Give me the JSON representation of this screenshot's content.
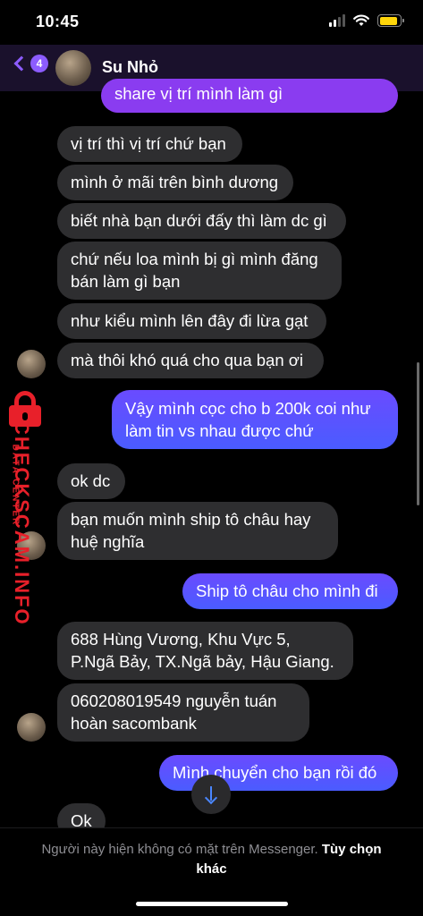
{
  "status": {
    "time": "10:45",
    "battery_level": 0.9
  },
  "header": {
    "back_badge": "4",
    "contact_name": "Su Nhỏ"
  },
  "messages": {
    "m0": "share vị trí mình làm gì",
    "m1": "vị trí thì vị trí chứ bạn",
    "m2": "mình ở mãi trên bình dương",
    "m3": "biết nhà bạn dưới đấy thì làm dc gì",
    "m4": "chứ nếu loa mình bị gì mình đăng\nbán làm gì bạn",
    "m5": "như kiểu mình lên đây đi lừa gạt",
    "m6": "mà thôi khó quá cho qua bạn ơi",
    "m7": "Vậy mình cọc cho b 200k coi như\nlàm tin vs nhau được chứ",
    "m8": "ok dc",
    "m9": "bạn muốn mình ship tô châu hay\nhuệ nghĩa",
    "m10": "Ship tô châu cho mình đi",
    "m11": "688 Hùng Vương, Khu Vực 5,\nP.Ngã Bảy, TX.Ngã bảy, Hậu Giang.",
    "m12": "060208019549 nguyễn tuán\nhoàn sacombank",
    "m13": "Mình chuyển cho bạn rồi đó",
    "m14": "Ok"
  },
  "watermark": {
    "brand": "CHECKSCAM.INFO",
    "sub": "DATA CENTER"
  },
  "footer": {
    "notice": "Người này hiện không có mặt trên Messenger.",
    "link": "Tùy chọn khác"
  },
  "colors": {
    "accent": "#8c5cff",
    "incoming": "#2e2e30",
    "outgoing": "#5a55ff",
    "watermark": "#e8202a"
  }
}
